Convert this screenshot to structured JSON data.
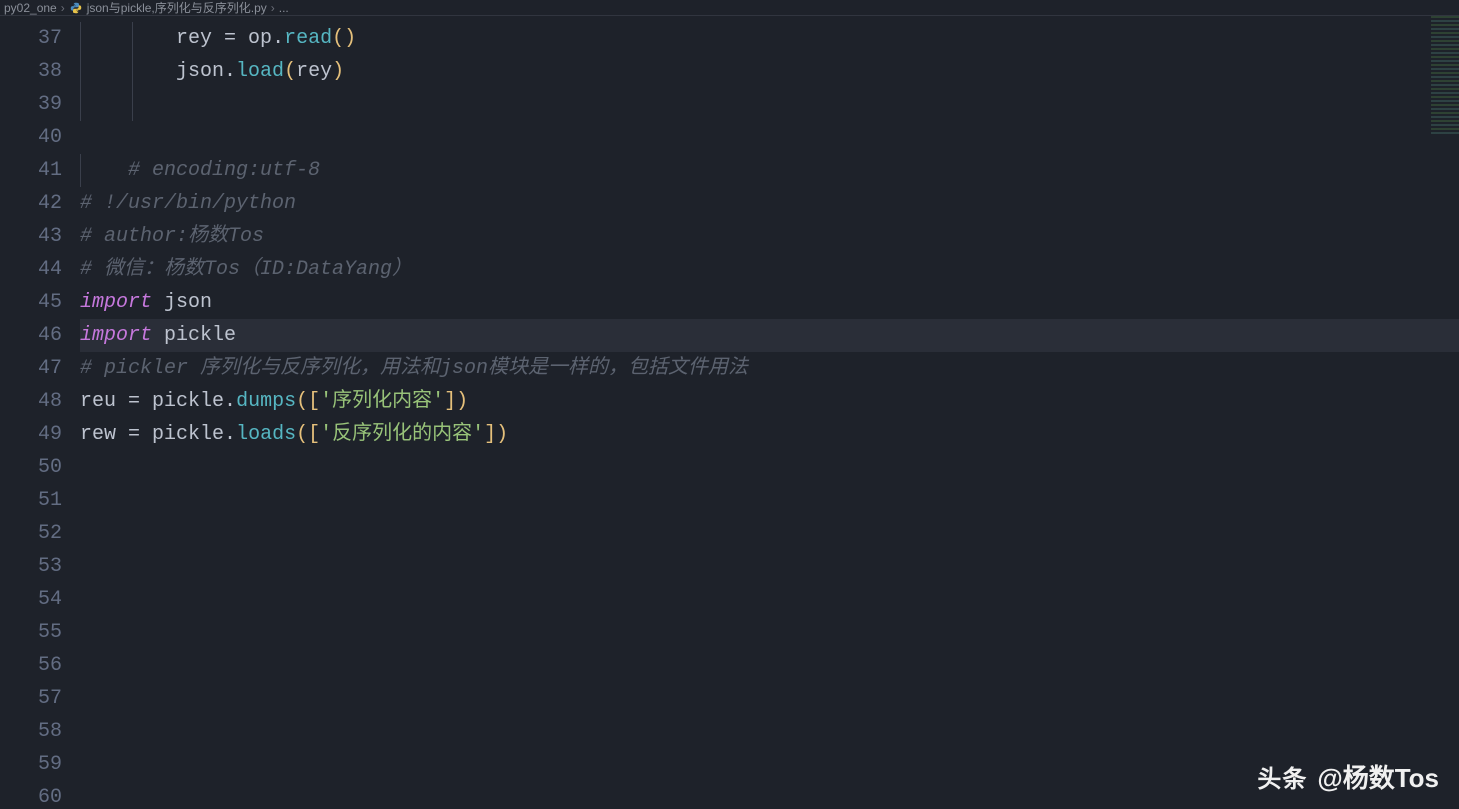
{
  "breadcrumb": {
    "root": "py02_one",
    "file": "json与pickle,序列化与反序列化.py",
    "trail": "..."
  },
  "gutter": {
    "start": 37,
    "end": 60
  },
  "highlight_line": 46,
  "code_lines": [
    {
      "n": 37,
      "indent": 2,
      "tokens": [
        {
          "t": "        ",
          "c": "tk-default"
        },
        {
          "t": "rey ",
          "c": "tk-prop"
        },
        {
          "t": "= ",
          "c": "tk-op"
        },
        {
          "t": "op",
          "c": "tk-prop"
        },
        {
          "t": ".",
          "c": "tk-op"
        },
        {
          "t": "read",
          "c": "tk-func"
        },
        {
          "t": "()",
          "c": "tk-paren"
        }
      ]
    },
    {
      "n": 38,
      "indent": 2,
      "tokens": [
        {
          "t": "        ",
          "c": "tk-default"
        },
        {
          "t": "json",
          "c": "tk-prop"
        },
        {
          "t": ".",
          "c": "tk-op"
        },
        {
          "t": "load",
          "c": "tk-func"
        },
        {
          "t": "(",
          "c": "tk-paren"
        },
        {
          "t": "rey",
          "c": "tk-prop"
        },
        {
          "t": ")",
          "c": "tk-paren"
        }
      ]
    },
    {
      "n": 39,
      "indent": 2,
      "tokens": []
    },
    {
      "n": 40,
      "indent": 0,
      "tokens": []
    },
    {
      "n": 41,
      "indent": 1,
      "tokens": [
        {
          "t": "    ",
          "c": "tk-default"
        },
        {
          "t": "# encoding:utf-8",
          "c": "tk-comment"
        }
      ]
    },
    {
      "n": 42,
      "indent": 0,
      "tokens": [
        {
          "t": "# !/usr/bin/python",
          "c": "tk-comment"
        }
      ]
    },
    {
      "n": 43,
      "indent": 0,
      "tokens": [
        {
          "t": "# author:杨数Tos",
          "c": "tk-comment"
        }
      ]
    },
    {
      "n": 44,
      "indent": 0,
      "tokens": [
        {
          "t": "# 微信：杨数Tos（ID:DataYang）",
          "c": "tk-comment"
        }
      ]
    },
    {
      "n": 45,
      "indent": 0,
      "tokens": [
        {
          "t": "import",
          "c": "tk-keyword"
        },
        {
          "t": " json",
          "c": "tk-module"
        }
      ]
    },
    {
      "n": 46,
      "indent": 0,
      "tokens": [
        {
          "t": "import",
          "c": "tk-keyword"
        },
        {
          "t": " pickle",
          "c": "tk-module"
        }
      ]
    },
    {
      "n": 47,
      "indent": 0,
      "tokens": [
        {
          "t": "# pickler 序列化与反序列化，用法和json模块是一样的，包括文件用法",
          "c": "tk-comment"
        }
      ]
    },
    {
      "n": 48,
      "indent": 0,
      "tokens": [
        {
          "t": "reu ",
          "c": "tk-prop"
        },
        {
          "t": "= ",
          "c": "tk-op"
        },
        {
          "t": "pickle",
          "c": "tk-prop"
        },
        {
          "t": ".",
          "c": "tk-op"
        },
        {
          "t": "dumps",
          "c": "tk-func"
        },
        {
          "t": "(",
          "c": "tk-paren"
        },
        {
          "t": "[",
          "c": "tk-brack"
        },
        {
          "t": "'序列化内容'",
          "c": "tk-string"
        },
        {
          "t": "]",
          "c": "tk-brack"
        },
        {
          "t": ")",
          "c": "tk-paren"
        }
      ]
    },
    {
      "n": 49,
      "indent": 0,
      "tokens": [
        {
          "t": "rew ",
          "c": "tk-prop"
        },
        {
          "t": "= ",
          "c": "tk-op"
        },
        {
          "t": "pickle",
          "c": "tk-prop"
        },
        {
          "t": ".",
          "c": "tk-op"
        },
        {
          "t": "loads",
          "c": "tk-func"
        },
        {
          "t": "(",
          "c": "tk-paren"
        },
        {
          "t": "[",
          "c": "tk-brack"
        },
        {
          "t": "'反序列化的内容'",
          "c": "tk-string"
        },
        {
          "t": "]",
          "c": "tk-brack"
        },
        {
          "t": ")",
          "c": "tk-paren"
        }
      ]
    },
    {
      "n": 50,
      "indent": 0,
      "tokens": []
    },
    {
      "n": 51,
      "indent": 0,
      "tokens": []
    },
    {
      "n": 52,
      "indent": 0,
      "tokens": []
    },
    {
      "n": 53,
      "indent": 0,
      "tokens": []
    },
    {
      "n": 54,
      "indent": 0,
      "tokens": []
    },
    {
      "n": 55,
      "indent": 0,
      "tokens": []
    },
    {
      "n": 56,
      "indent": 0,
      "tokens": []
    },
    {
      "n": 57,
      "indent": 0,
      "tokens": []
    },
    {
      "n": 58,
      "indent": 0,
      "tokens": []
    },
    {
      "n": 59,
      "indent": 0,
      "tokens": []
    },
    {
      "n": 60,
      "indent": 0,
      "tokens": []
    }
  ],
  "watermark": {
    "logo": "头条",
    "text": "@杨数Tos"
  },
  "colors": {
    "bg": "#1e222a",
    "gutter": "#636d83",
    "comment": "#5c6370",
    "keyword": "#c678dd",
    "string": "#98c379",
    "func": "#56b6c2",
    "punc": "#e5c07b"
  }
}
